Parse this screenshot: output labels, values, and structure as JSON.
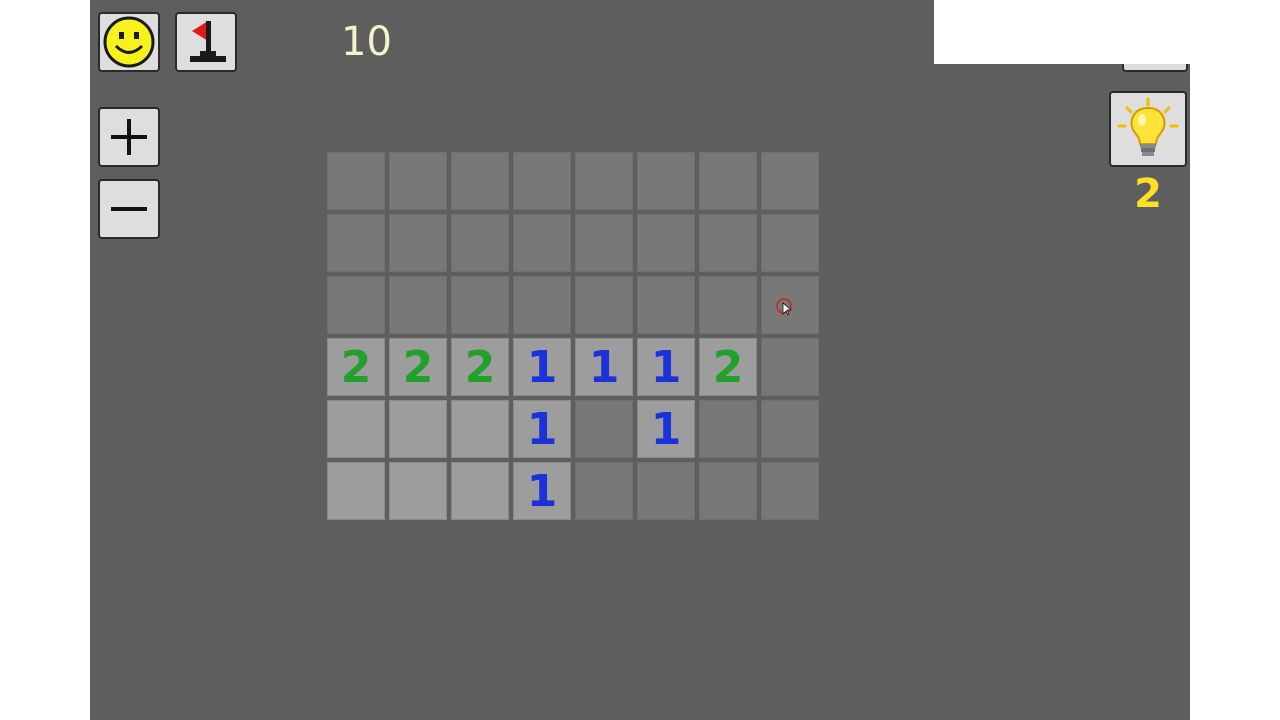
{
  "toolbar": {
    "smiley_icon": "smiley-face-icon",
    "flag_icon": "flag-icon",
    "mine_counter": "10",
    "zoom_in_icon": "plus-icon",
    "zoom_out_icon": "minus-icon"
  },
  "hint": {
    "icon": "lightbulb-icon",
    "count": "2"
  },
  "board": {
    "rows": [
      [
        "",
        "",
        "",
        "",
        "",
        "",
        "",
        ""
      ],
      [
        "",
        "",
        "",
        "",
        "",
        "",
        "",
        ""
      ],
      [
        "",
        "",
        "",
        "",
        "",
        "",
        "",
        ""
      ],
      [
        "2",
        "2",
        "2",
        "1",
        "1",
        "1",
        "2",
        ""
      ],
      [
        "",
        "",
        "",
        "1",
        "",
        "1",
        "",
        ""
      ],
      [
        "",
        "",
        "",
        "1",
        "",
        "",
        "",
        ""
      ]
    ],
    "states": [
      [
        "covered",
        "covered",
        "covered",
        "covered",
        "covered",
        "covered",
        "covered",
        "covered"
      ],
      [
        "covered",
        "covered",
        "covered",
        "covered",
        "covered",
        "covered",
        "covered",
        "covered"
      ],
      [
        "covered",
        "covered",
        "covered",
        "covered",
        "covered",
        "covered",
        "covered",
        "covered"
      ],
      [
        "revealed",
        "revealed",
        "revealed",
        "revealed",
        "revealed",
        "revealed",
        "revealed",
        "covered"
      ],
      [
        "revealed",
        "revealed",
        "revealed",
        "revealed",
        "covered",
        "revealed",
        "covered",
        "covered"
      ],
      [
        "revealed",
        "revealed",
        "revealed",
        "revealed",
        "covered",
        "covered",
        "covered",
        "covered"
      ]
    ]
  },
  "colors": {
    "background": "#5e5e5e",
    "covered_cell": "#787878",
    "revealed_cell": "#9d9d9d",
    "number_1": "#1a32d8",
    "number_2": "#22a02c",
    "counter_text": "#f4f4cc",
    "hint_count": "#ffe028"
  }
}
